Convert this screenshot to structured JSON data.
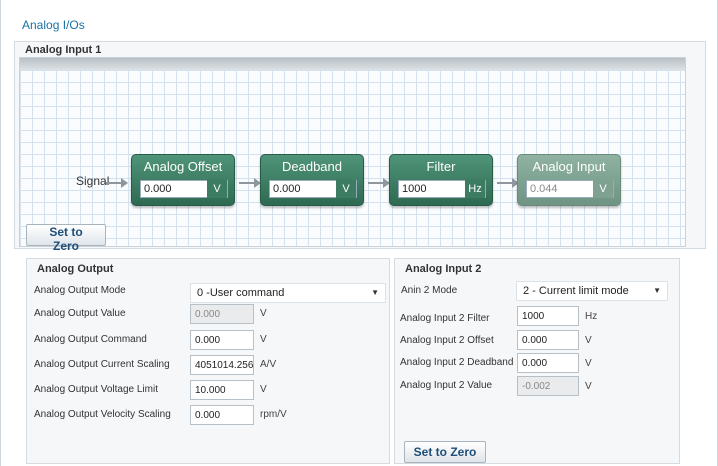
{
  "page": {
    "title": "Analog I/Os"
  },
  "analog_input_1": {
    "title": "Analog Input 1",
    "signal_label": "Signal",
    "blocks": [
      {
        "title": "Analog Offset",
        "value": "0.000",
        "unit": "V"
      },
      {
        "title": "Deadband",
        "value": "0.000",
        "unit": "V"
      },
      {
        "title": "Filter",
        "value": "1000",
        "unit": "Hz"
      },
      {
        "title": "Analog Input",
        "value": "0.044",
        "unit": "V"
      }
    ],
    "set_to_zero": "Set to Zero"
  },
  "analog_output": {
    "title": "Analog Output",
    "mode_label": "Analog Output Mode",
    "mode_value": "0 -User command",
    "rows": [
      {
        "label": "Analog Output Value",
        "value": "0.000",
        "unit": "V"
      },
      {
        "label": "Analog Output Command",
        "value": "0.000",
        "unit": "V"
      },
      {
        "label": "Analog Output Current Scaling",
        "value": "4051014.256",
        "unit": "A/V"
      },
      {
        "label": "Analog Output Voltage Limit",
        "value": "10.000",
        "unit": "V"
      },
      {
        "label": "Analog Output Velocity Scaling",
        "value": "0.000",
        "unit": "rpm/V"
      }
    ]
  },
  "analog_input_2": {
    "title": "Analog Input 2",
    "mode_label": "Anin 2 Mode",
    "mode_value": "2 - Current limit mode",
    "rows": [
      {
        "label": "Analog Input 2 Filter",
        "value": "1000",
        "unit": "Hz"
      },
      {
        "label": "Analog Input 2 Offset",
        "value": "0.000",
        "unit": "V"
      },
      {
        "label": "Analog Input 2 Deadband",
        "value": "0.000",
        "unit": "V"
      },
      {
        "label": "Analog Input 2 Value",
        "value": "-0.002",
        "unit": "V"
      }
    ],
    "set_to_zero": "Set to Zero"
  }
}
